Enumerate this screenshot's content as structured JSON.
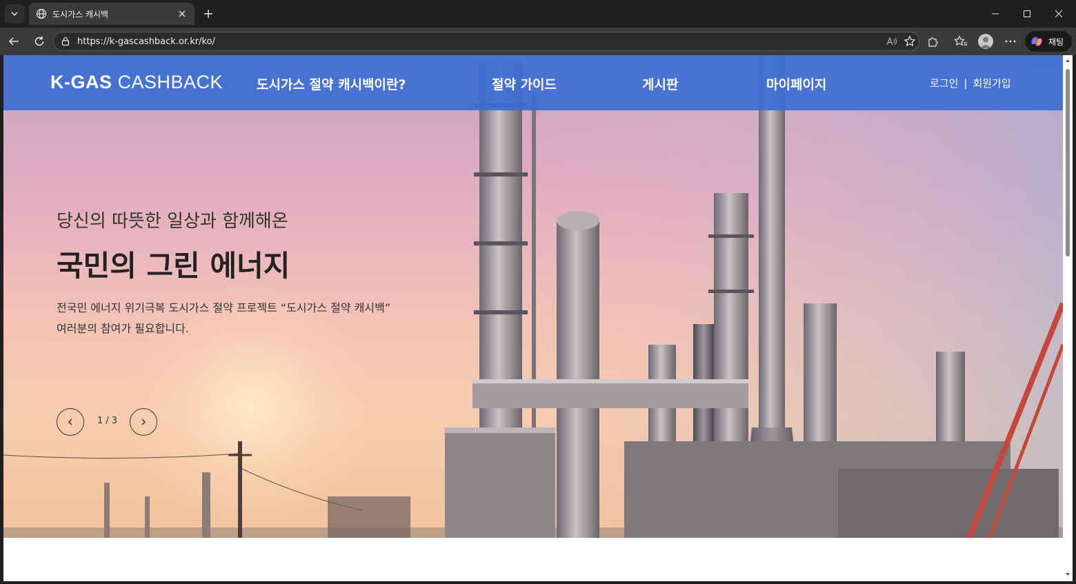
{
  "browser": {
    "tab_title": "도시가스 캐시백",
    "url": "https://k-gascashback.or.kr/ko/",
    "copilot_label": "채팅"
  },
  "site": {
    "logo_bold": "K-GAS",
    "logo_light": " CASHBACK",
    "menu": [
      "도시가스 절약 캐시백이란?",
      "절약 가이드",
      "게시판",
      "마이페이지"
    ],
    "login": "로그인",
    "separator": "|",
    "signup": "회원가입"
  },
  "hero": {
    "subtitle": "당신의 따뜻한 일상과 함께해온",
    "title": "국민의 그린 에너지",
    "desc_line1": "전국민 에너지 위기극복 도시가스 절약 프로젝트 “도시가스 절약 캐시백”",
    "desc_line2": "여러분의 참여가 필요합니다.",
    "slide_counter": "1 / 3",
    "slide_current": 1,
    "slide_total": 3
  },
  "colors": {
    "gnb": "#3c6ed2",
    "chrome_dark": "#1f1f1f",
    "chrome_toolbar": "#3a3a3a"
  }
}
